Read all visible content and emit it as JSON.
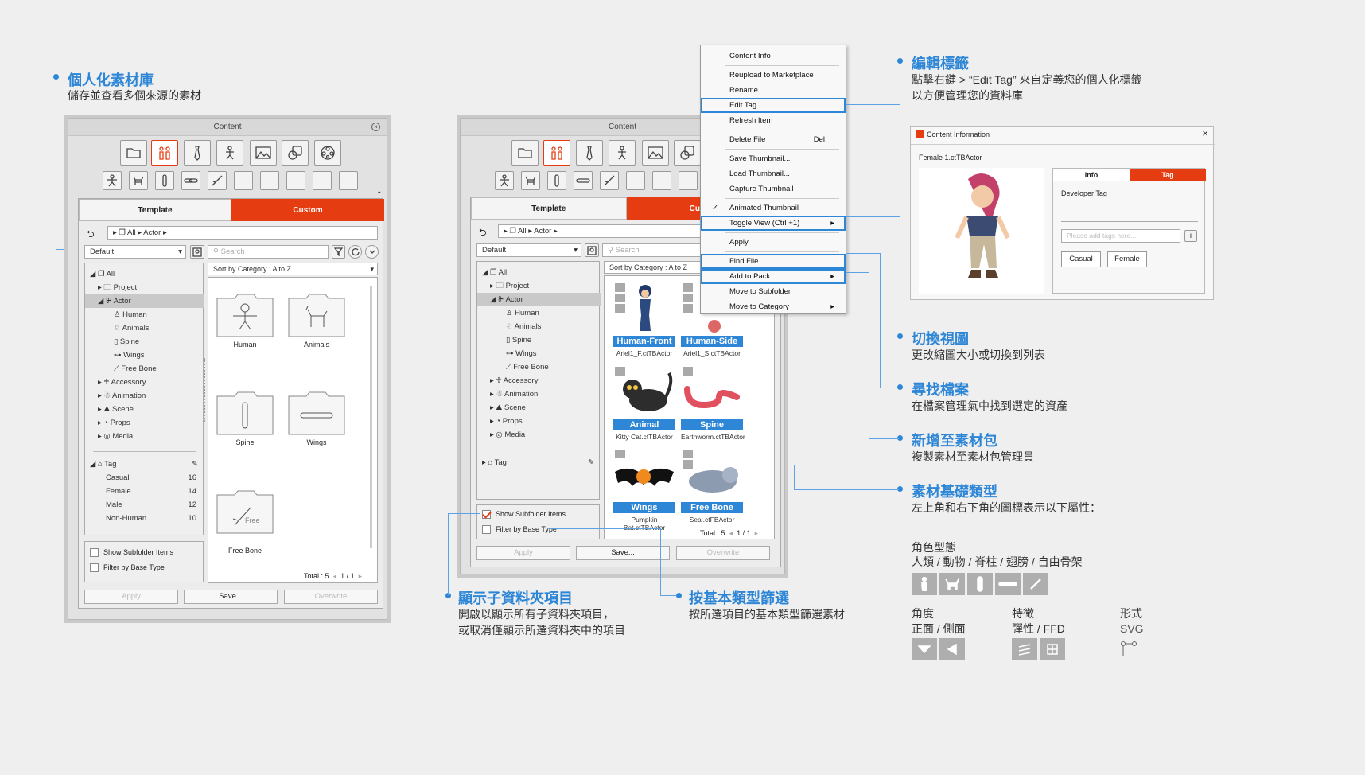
{
  "callouts": {
    "c1": {
      "title": "個人化素材庫",
      "desc": "儲存並查看多個來源的素材"
    },
    "c2": {
      "title": "編輯標籤",
      "desc1": "點擊右鍵 > “Edit Tag” 來自定義您的個人化標籤",
      "desc2": "以方便管理您的資料庫"
    },
    "c3": {
      "title": "切換視圖",
      "desc": "更改縮圖大小或切換到列表"
    },
    "c4": {
      "title": "尋找檔案",
      "desc": "在檔案管理氣中找到選定的資產"
    },
    "c5": {
      "title": "新增至素材包",
      "desc": "複製素材至素材包管理員"
    },
    "c6": {
      "title": "素材基礎類型",
      "desc": "左上角和右下角的圖標表示以下屬性："
    },
    "c7": {
      "title": "顯示子資料夾項目",
      "desc1": "開啟以顯示所有子資料夾項目，",
      "desc2": "或取消僅顯示所選資料夾中的項目"
    },
    "c8": {
      "title": "按基本類型篩選",
      "desc": "按所選項目的基本類型篩選素材"
    }
  },
  "legend": {
    "g1_title": "角色型態",
    "g1_desc": "人類 / 動物 / 脊柱 / 翅膀 / 自由骨架",
    "g2_title": "角度",
    "g2_desc": "正面 / 側面",
    "g3_title": "特徵",
    "g3_desc": "彈性 / FFD",
    "g4_title": "形式",
    "g4_desc": "SVG",
    "icons": [
      "human-icon",
      "animal-icon",
      "spine-icon",
      "wings-icon",
      "free-bone-icon",
      "front-icon",
      "side-icon",
      "elastic-icon",
      "ffd-icon",
      "svg-icon"
    ]
  },
  "panel_common": {
    "title": "Content",
    "tab_template": "Template",
    "tab_custom": "Custom",
    "crumb_all": "All",
    "crumb_actor": "Actor",
    "default": "Default",
    "search": "Search",
    "sort": "Sort by Category : A to Z",
    "tree": {
      "all": "All",
      "project": "Project",
      "actor": "Actor",
      "human": "Human",
      "animals": "Animals",
      "spine": "Spine",
      "wings": "Wings",
      "freebone": "Free Bone",
      "accessory": "Accessory",
      "animation": "Animation",
      "scene": "Scene",
      "props": "Props",
      "media": "Media",
      "tag": "Tag"
    },
    "show_sub": "Show Subfolder Items",
    "filter_base": "Filter by Base Type",
    "apply": "Apply",
    "save": "Save...",
    "overwrite": "Overwrite",
    "total": "Total : 5",
    "page": "1  /  1"
  },
  "panel1": {
    "tags": [
      {
        "name": "Casual",
        "count": "16"
      },
      {
        "name": "Female",
        "count": "14"
      },
      {
        "name": "Male",
        "count": "12"
      },
      {
        "name": "Non-Human",
        "count": "10"
      }
    ],
    "folders": [
      "Human",
      "Animals",
      "Spine",
      "Wings",
      "Free Bone"
    ],
    "free_text": "Free"
  },
  "panel2": {
    "thumbs": [
      {
        "bar": "Human-Front",
        "cap": "Ariel1_F.ctTBActor"
      },
      {
        "bar": "Human-Side",
        "cap": "Ariel1_S.ctTBActor"
      },
      {
        "bar": "Animal",
        "cap": "Kitty Cat.ctTBActor"
      },
      {
        "bar": "Spine",
        "cap": "Earthworm.ctTBActor"
      },
      {
        "bar": "Wings",
        "cap": "Pumpkin Bat.ctTBActor"
      },
      {
        "bar": "Free Bone",
        "cap": "Seal.ctFBActor"
      }
    ]
  },
  "menu": {
    "items": [
      "Content Info",
      "Reupload to Marketplace",
      "Rename",
      "Edit Tag...",
      "Refresh Item",
      "Delete File",
      "Save Thumbnail...",
      "Load Thumbnail...",
      "Capture Thumbnail",
      "Animated Thumbnail",
      "Toggle View (Ctrl +1)",
      "Apply",
      "Find File",
      "Add to Pack",
      "Move to Subfolder",
      "Move to Category"
    ],
    "del_shortcut": "Del"
  },
  "info": {
    "title": "Content Information",
    "file": "Female 1.ctTBActor",
    "tab_info": "Info",
    "tab_tag": "Tag",
    "dev_tag": "Developer Tag :",
    "placeholder": "Please add tags here...",
    "tags": [
      "Casual",
      "Female"
    ]
  },
  "colors": {
    "accent": "#e63c12",
    "blue": "#2e86d6"
  }
}
